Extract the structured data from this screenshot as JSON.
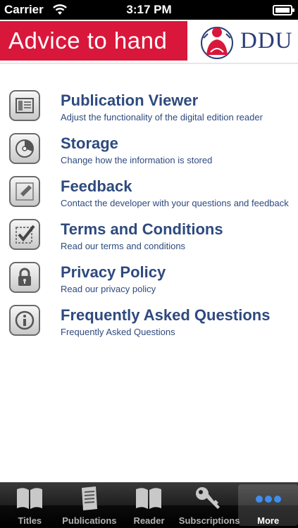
{
  "status_bar": {
    "carrier": "Carrier",
    "time": "3:17 PM"
  },
  "header": {
    "banner_text": "Advice to hand",
    "brand_text": "DDU"
  },
  "menu": [
    {
      "title": "Publication Viewer",
      "subtitle": "Adjust the functionality of the digital edition reader",
      "icon": "viewer-icon"
    },
    {
      "title": "Storage",
      "subtitle": "Change how the information is stored",
      "icon": "storage-icon"
    },
    {
      "title": "Feedback",
      "subtitle": "Contact the developer with your questions and feedback",
      "icon": "pencil-icon"
    },
    {
      "title": "Terms and Conditions",
      "subtitle": "Read our terms and conditions",
      "icon": "checkbox-icon"
    },
    {
      "title": "Privacy Policy",
      "subtitle": "Read our privacy policy",
      "icon": "lock-icon"
    },
    {
      "title": "Frequently Asked Questions",
      "subtitle": "Frequently Asked Questions",
      "icon": "info-icon"
    }
  ],
  "tabs": [
    {
      "label": "Titles",
      "icon": "book-icon"
    },
    {
      "label": "Publications",
      "icon": "publications-icon"
    },
    {
      "label": "Reader",
      "icon": "reader-icon"
    },
    {
      "label": "Subscriptions",
      "icon": "key-icon"
    },
    {
      "label": "More",
      "icon": "more-dots-icon",
      "active": true
    }
  ],
  "colors": {
    "banner": "#d9173b",
    "brand": "#2b3d78",
    "item_text": "#2e4a7e"
  }
}
